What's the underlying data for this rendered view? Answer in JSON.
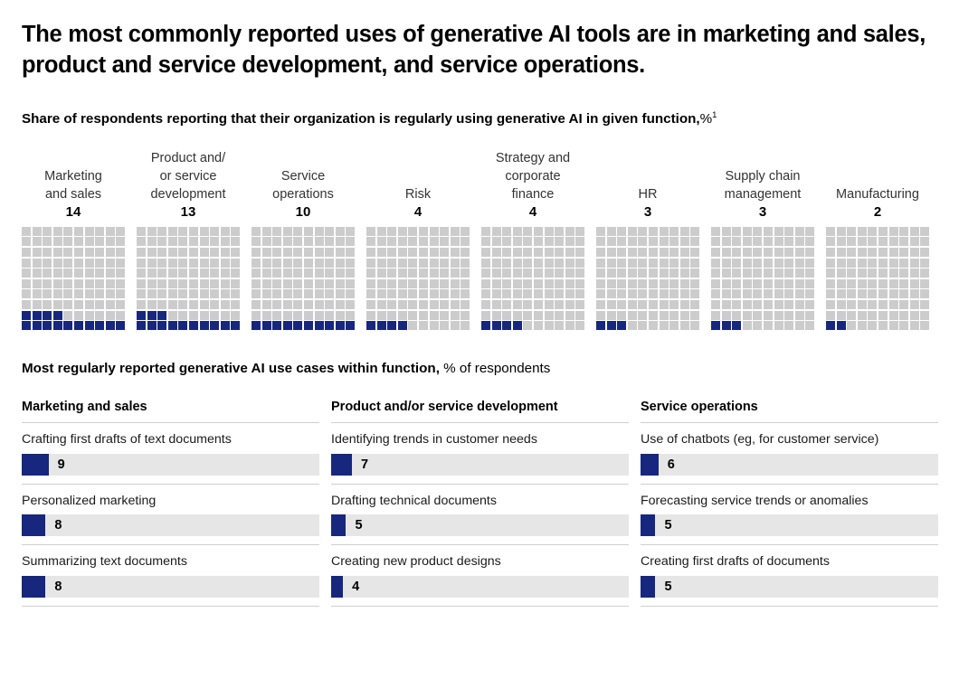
{
  "headline": "The most commonly reported uses of generative AI tools are in marketing and sales, product and service development, and service operations.",
  "subtitle": {
    "bold_part": "Share of respondents reporting that their organization is regularly using generative AI in given function,",
    "unit": "%",
    "footnote_marker": "1"
  },
  "colors": {
    "accent_blue": "#17277e",
    "cell_gray": "#cccccc",
    "bar_track_gray": "#e6e6e6",
    "divider_gray": "#cfcfcf"
  },
  "waffles": {
    "total_cells": 100,
    "grid_columns": 10,
    "grid_rows": 10,
    "items": [
      {
        "label": "Marketing\nand sales",
        "value": 14
      },
      {
        "label": "Product and/\nor service\ndevelopment",
        "value": 13
      },
      {
        "label": "Service\noperations",
        "value": 10
      },
      {
        "label": "Risk",
        "value": 4
      },
      {
        "label": "Strategy and\ncorporate\nfinance",
        "value": 4
      },
      {
        "label": "HR",
        "value": 3
      },
      {
        "label": "Supply chain\nmanagement",
        "value": 3
      },
      {
        "label": "Manufacturing",
        "value": 2
      }
    ]
  },
  "lower_section": {
    "title_bold": "Most regularly reported generative AI use cases within function,",
    "title_light": "% of respondents",
    "max_value": 100,
    "columns": [
      {
        "header": "Marketing and sales",
        "cases": [
          {
            "label": "Crafting first drafts of text documents",
            "value": 9
          },
          {
            "label": "Personalized marketing",
            "value": 8
          },
          {
            "label": "Summarizing text documents",
            "value": 8
          }
        ]
      },
      {
        "header": "Product and/or service development",
        "cases": [
          {
            "label": "Identifying trends in customer needs",
            "value": 7
          },
          {
            "label": "Drafting technical documents",
            "value": 5
          },
          {
            "label": "Creating new product designs",
            "value": 4
          }
        ]
      },
      {
        "header": "Service operations",
        "cases": [
          {
            "label": "Use of chatbots (eg, for customer service)",
            "value": 6
          },
          {
            "label": "Forecasting service trends or anomalies",
            "value": 5
          },
          {
            "label": "Creating first drafts of documents",
            "value": 5
          }
        ]
      }
    ]
  },
  "chart_data": [
    {
      "type": "bar",
      "title": "Share of respondents reporting that their organization is regularly using generative AI in given function, %",
      "subtype": "waffle",
      "categories": [
        "Marketing and sales",
        "Product and/or service development",
        "Service operations",
        "Risk",
        "Strategy and corporate finance",
        "HR",
        "Supply chain management",
        "Manufacturing"
      ],
      "values": [
        14,
        13,
        10,
        4,
        4,
        3,
        3,
        2
      ],
      "xlabel": "",
      "ylabel": "Share of respondents, %",
      "ylim": [
        0,
        100
      ],
      "grid": false,
      "legend": "none"
    },
    {
      "type": "bar",
      "title": "Most regularly reported generative AI use cases within function, % of respondents",
      "orientation": "horizontal",
      "groups": [
        {
          "name": "Marketing and sales",
          "categories": [
            "Crafting first drafts of text documents",
            "Personalized marketing",
            "Summarizing text documents"
          ],
          "values": [
            9,
            8,
            8
          ]
        },
        {
          "name": "Product and/or service development",
          "categories": [
            "Identifying trends in customer needs",
            "Drafting technical documents",
            "Creating new product designs"
          ],
          "values": [
            7,
            5,
            4
          ]
        },
        {
          "name": "Service operations",
          "categories": [
            "Use of chatbots (eg, for customer service)",
            "Forecasting service trends or anomalies",
            "Creating first drafts of documents"
          ],
          "values": [
            6,
            5,
            5
          ]
        }
      ],
      "xlabel": "% of respondents",
      "ylabel": "",
      "xlim": [
        0,
        100
      ],
      "grid": false,
      "legend": "none"
    }
  ]
}
